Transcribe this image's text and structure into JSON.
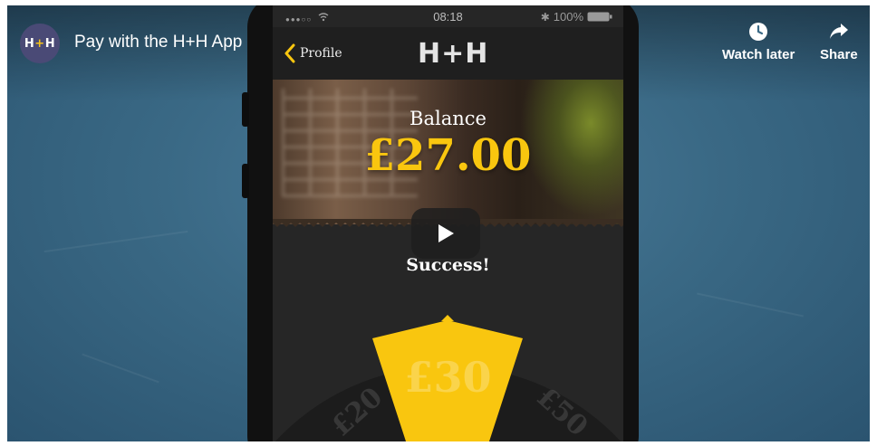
{
  "video": {
    "channel_logo_text_left": "H",
    "channel_logo_text_plus": "+",
    "channel_logo_text_right": "H",
    "title": "Pay with the H+H App",
    "actions": [
      {
        "label": "Watch later",
        "icon": "clock-icon"
      },
      {
        "label": "Share",
        "icon": "share-arrow-icon"
      }
    ],
    "play_icon": "play-icon"
  },
  "phone": {
    "statusbar": {
      "signal": "●●●○○",
      "time": "08:18",
      "battery": "100%"
    },
    "navbar": {
      "back_label": "Profile",
      "app_logo": "H+H"
    },
    "balance": {
      "label": "Balance",
      "amount": "£27.00"
    },
    "status_message": "Success!",
    "amount_dial": {
      "left": "£20",
      "selected": "£30",
      "right": "£50"
    }
  },
  "colors": {
    "accent": "#f9c60f",
    "chalkboard": "#3a6985",
    "screen_bg": "#262626"
  }
}
